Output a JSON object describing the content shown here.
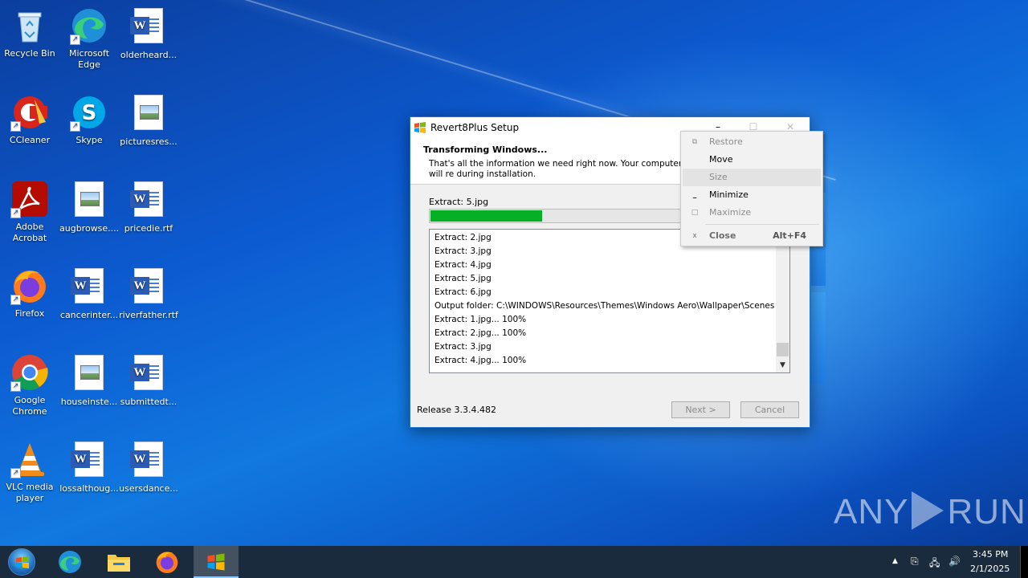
{
  "desktop": {
    "icons": [
      {
        "label": "Recycle Bin"
      },
      {
        "label": "Microsoft Edge"
      },
      {
        "label": "olderheard..."
      },
      {
        "label": "CCleaner"
      },
      {
        "label": "Skype"
      },
      {
        "label": "picturesres..."
      },
      {
        "label": "Adobe Acrobat"
      },
      {
        "label": "augbrowse...."
      },
      {
        "label": "pricedie.rtf"
      },
      {
        "label": "Firefox"
      },
      {
        "label": "cancerinter..."
      },
      {
        "label": "riverfather.rtf"
      },
      {
        "label": "Google Chrome"
      },
      {
        "label": "houseinste..."
      },
      {
        "label": "submittedt..."
      },
      {
        "label": "VLC media player"
      },
      {
        "label": "lossalthoug..."
      },
      {
        "label": "usersdance..."
      }
    ]
  },
  "setup_window": {
    "title": "Revert8Plus Setup",
    "header_title": "Transforming Windows...",
    "header_subtitle": "That's all the information we need right now. Your computer will re during installation.",
    "status": "Extract: 5.jpg",
    "progress_fraction": 0.31,
    "log_lines": [
      "Extract: 2.jpg",
      "Extract: 3.jpg",
      "Extract: 4.jpg",
      "Extract: 5.jpg",
      "Extract: 6.jpg",
      "Output folder: C:\\WINDOWS\\Resources\\Themes\\Windows Aero\\Wallpaper\\Scenes",
      "Extract: 1.jpg... 100%",
      "Extract: 2.jpg... 100%",
      "Extract: 3.jpg",
      "Extract: 4.jpg... 100%"
    ],
    "release": "Release 3.3.4.482",
    "next_label": "Next >",
    "cancel_label": "Cancel"
  },
  "system_menu": {
    "items": [
      {
        "label": "Restore",
        "enabled": false
      },
      {
        "label": "Move",
        "enabled": true
      },
      {
        "label": "Size",
        "enabled": false
      },
      {
        "label": "Minimize",
        "enabled": true
      },
      {
        "label": "Maximize",
        "enabled": false
      },
      {
        "label": "Close",
        "enabled": false,
        "accel": "Alt+F4"
      }
    ]
  },
  "watermark": {
    "left": "ANY",
    "right": "RUN"
  },
  "taskbar": {
    "time": "3:45 PM",
    "date": "2/1/2025"
  }
}
